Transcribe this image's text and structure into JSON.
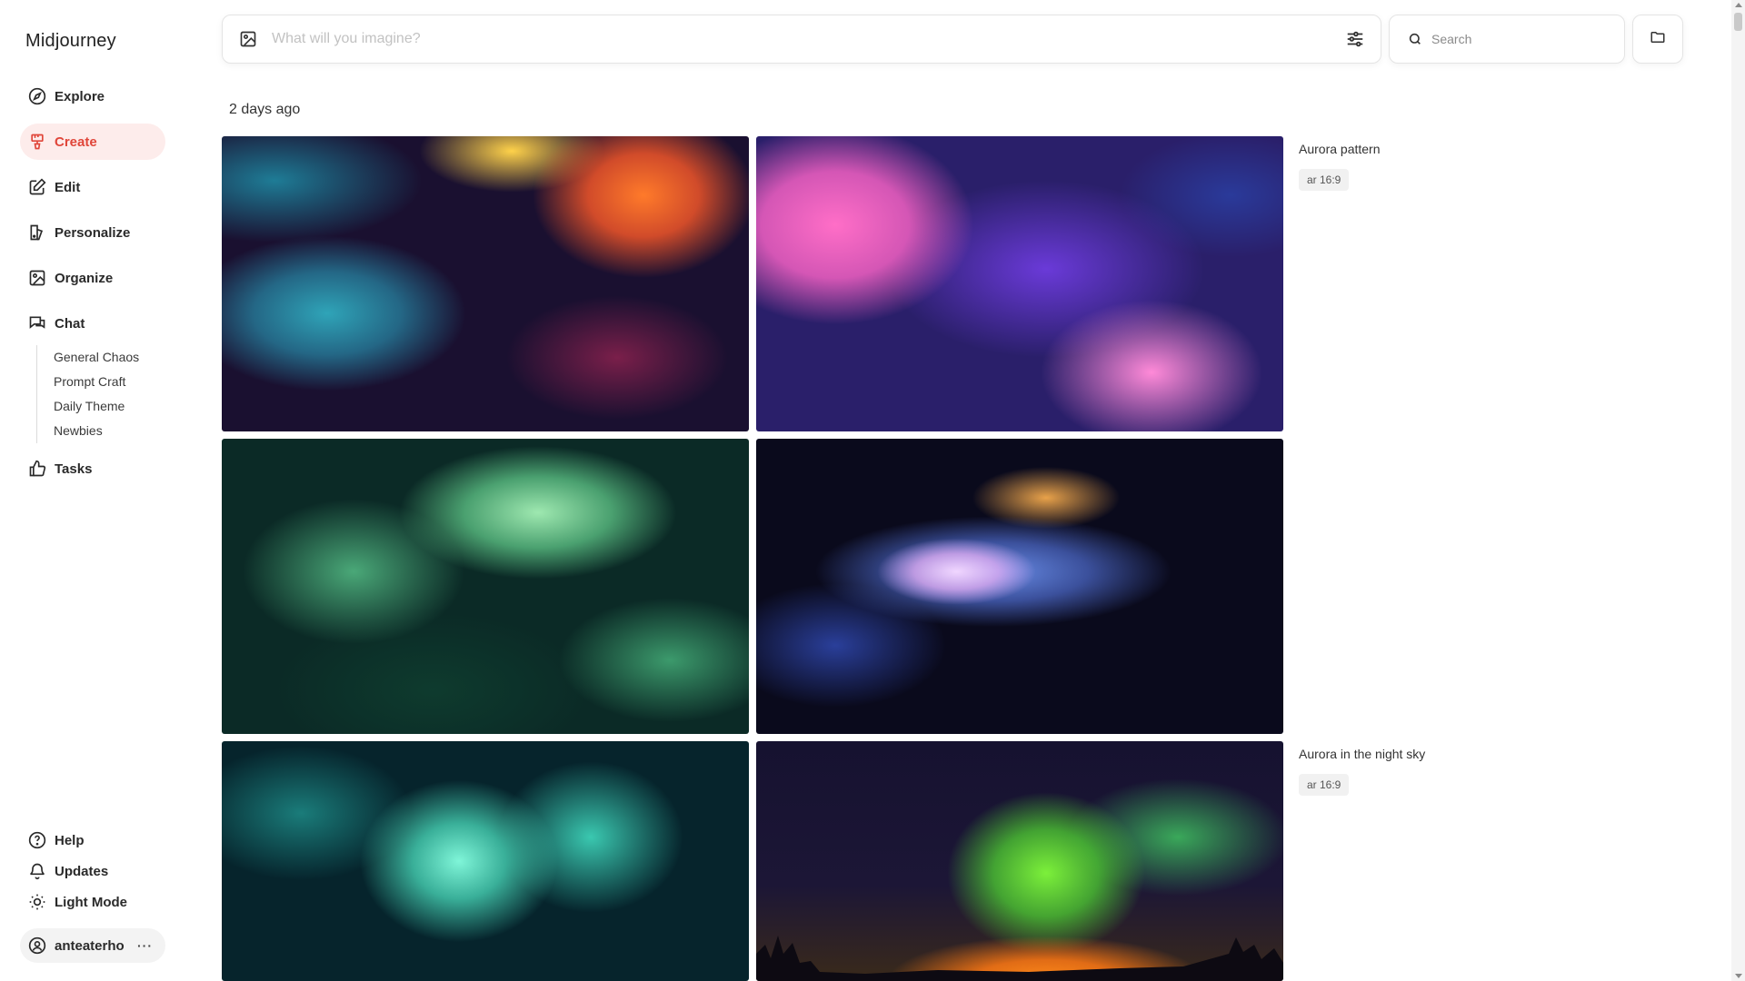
{
  "app": {
    "name": "Midjourney"
  },
  "nav": {
    "items": [
      {
        "label": "Explore",
        "icon": "compass-icon"
      },
      {
        "label": "Create",
        "icon": "brush-icon",
        "active": true
      },
      {
        "label": "Edit",
        "icon": "edit-icon"
      },
      {
        "label": "Personalize",
        "icon": "personalize-icon"
      },
      {
        "label": "Organize",
        "icon": "image-icon"
      },
      {
        "label": "Chat",
        "icon": "chat-icon"
      }
    ],
    "chat_channels": [
      "General Chaos",
      "Prompt Craft",
      "Daily Theme",
      "Newbies"
    ],
    "tasks": {
      "label": "Tasks",
      "icon": "thumbs-up-icon"
    }
  },
  "bottom_nav": {
    "help": "Help",
    "updates": "Updates",
    "light_mode": "Light Mode"
  },
  "user": {
    "name": "anteaterho",
    "more": "···"
  },
  "prompt_bar": {
    "placeholder": "What will you imagine?"
  },
  "search": {
    "placeholder": "Search"
  },
  "feed": {
    "date_label": "2 days ago",
    "groups": [
      {
        "prompt": "Aurora pattern",
        "params": "ar 16:9"
      },
      {
        "prompt": "Aurora in the night sky",
        "params": "ar 16:9"
      }
    ]
  },
  "colors": {
    "accent": "#e0463a",
    "active_bg": "#fdeceb"
  }
}
